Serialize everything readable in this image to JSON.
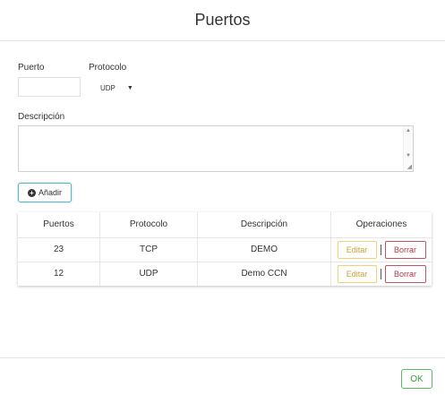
{
  "header": {
    "title": "Puertos"
  },
  "form": {
    "port_label": "Puerto",
    "port_value": "",
    "protocol_label": "Protocolo",
    "protocol_selected": "UDP",
    "description_label": "Descripción",
    "description_value": "",
    "add_label": "Añadir"
  },
  "table": {
    "headers": [
      "Puertos",
      "Protocolo",
      "Descripción",
      "Operaciones"
    ],
    "rows": [
      {
        "port": "23",
        "protocol": "TCP",
        "description": "DEMO",
        "edit_label": "Editar",
        "delete_label": "Borrar"
      },
      {
        "port": "12",
        "protocol": "UDP",
        "description": "Demo CCN",
        "edit_label": "Editar",
        "delete_label": "Borrar"
      }
    ]
  },
  "footer": {
    "ok_label": "OK"
  },
  "icons": {
    "add": "plus-circle-icon",
    "select_caret": "caret-down-icon",
    "scroll_up": "arrow-up-icon",
    "scroll_down": "arrow-down-icon",
    "resize": "resize-grip-icon"
  },
  "colors": {
    "add_border": "#5bb8c4",
    "edit": "#f0d27a",
    "delete": "#b85a66",
    "ok": "#5cb85c"
  }
}
